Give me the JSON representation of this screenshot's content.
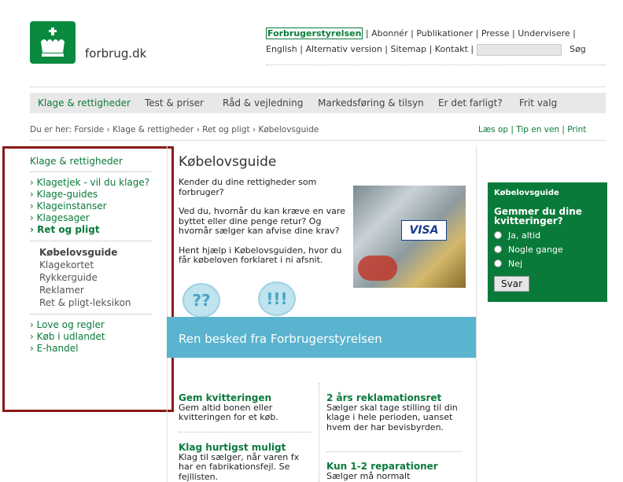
{
  "brand": {
    "logo_text": "forbrug.dk"
  },
  "toplinks": {
    "row1": [
      "Forbrugerstyrelsen",
      "Abonnér",
      "Publikationer",
      "Presse",
      "Undervisere"
    ],
    "row2": [
      "English",
      "Alternativ version",
      "Sitemap",
      "Kontakt"
    ],
    "search_button": "Søg"
  },
  "mainnav": [
    "Klage & rettigheder",
    "Test & priser",
    "Råd & vejledning",
    "Markedsføring & tilsyn",
    "Er det farligt?",
    "Frit valg"
  ],
  "breadcrumb": "Du er her: Forside › Klage & rettigheder › Ret og pligt › Købelovsguide",
  "tools": "Læs op | Tip en ven | Print",
  "leftnav": {
    "heading": "Klage & rettigheder",
    "items": [
      "› Klagetjek - vil du klage?",
      "› Klage-guides",
      "› Klageinstanser",
      "› Klagesager",
      "› Ret og pligt"
    ],
    "subitems": [
      "Købelovsguide",
      "Klagekortet",
      "Rykkerguide",
      "Reklamer",
      "Ret & pligt-leksikon"
    ],
    "items2": [
      "› Love og regler",
      "› Køb i udlandet",
      "› E-handel"
    ]
  },
  "content": {
    "title": "Købelovsguide",
    "p1": "Kender du dine rettigheder som forbruger?",
    "p2": "Ved du, hvornår du kan kræve en vare byttet eller dine penge retur? Og hvornår sælger kan afvise dine krav?",
    "p3": "Hent hjælp i Købelovsguiden, hvor du får købeloven forklaret i ni afsnit.",
    "visa": "VISA",
    "banner": "Ren besked fra Forbrugerstyrelsen",
    "bubble1": "??",
    "bubble2": "!!!"
  },
  "articles": [
    {
      "title": "Gem kvitteringen",
      "text": "Gem altid bonen eller kvitteringen for et køb."
    },
    {
      "title": "Klag hurtigst muligt",
      "text": "Klag til sælger, når varen fx har en fabrikationsfejl. Se fejllisten."
    },
    {
      "title": "2 års reklamationsret",
      "text": "Sælger skal tage stilling til din klage i hele perioden, uanset hvem der har bevisbyrden."
    },
    {
      "title": "Kun 1-2 reparationer",
      "text": "Sælger må normalt"
    }
  ],
  "poll": {
    "title": "Købelovsguide",
    "question": "Gemmer du dine kvitteringer?",
    "options": [
      "Ja, altid",
      "Nogle gange",
      "Nej"
    ],
    "button": "Svar"
  },
  "colors": {
    "brand_green": "#0a7a3a",
    "banner_blue": "#5ab3cf",
    "highlight_red": "#8b1a1a"
  }
}
